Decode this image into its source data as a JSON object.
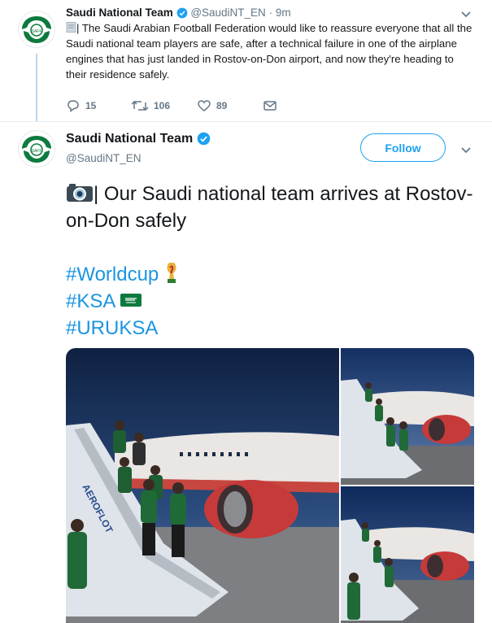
{
  "tweet1": {
    "name": "Saudi National Team",
    "handle": "@SaudiNT_EN",
    "time": "· 9m",
    "text": "| The Saudi Arabian Football Federation would like to reassure everyone that all the Saudi national team players are safe, after a technical failure in one of the airplane engines that has just landed in Rostov-on-Don airport, and now they're heading to their residence safely.",
    "replies": "15",
    "retweets": "106",
    "likes": "89"
  },
  "tweet2": {
    "name": "Saudi National Team",
    "handle": "@SaudiNT_EN",
    "follow_label": "Follow",
    "text": "| Our Saudi national team arrives at Rostov-on-Don safely",
    "hashtags": [
      "#Worldcup",
      "#KSA",
      "#URUKSA"
    ]
  },
  "avatar_text": "SAFF",
  "colors": {
    "accent": "#1da1f2",
    "hashtag": "#1b95e0",
    "brand_green": "#0d7a3e"
  }
}
